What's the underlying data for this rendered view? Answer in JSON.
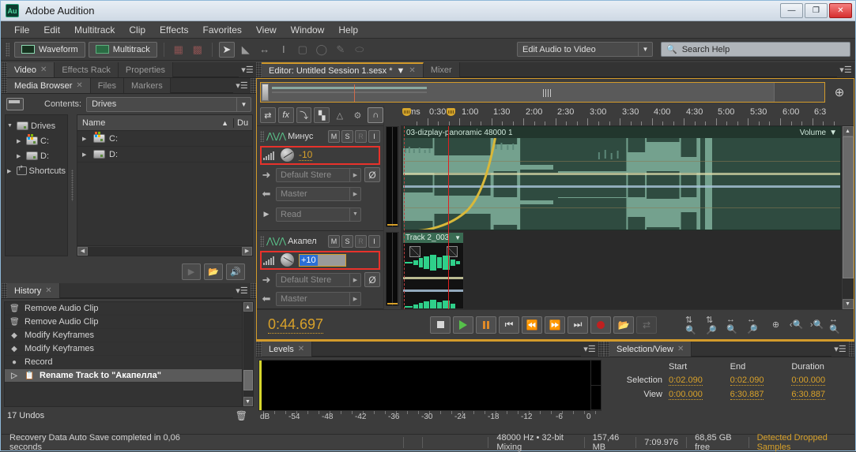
{
  "window": {
    "app_icon": "Au",
    "title": "Adobe Audition",
    "minimize": "—",
    "maximize": "❐",
    "close": "✕"
  },
  "menu": [
    "File",
    "Edit",
    "Multitrack",
    "Clip",
    "Effects",
    "Favorites",
    "View",
    "Window",
    "Help"
  ],
  "toolbar": {
    "waveform_label": "Waveform",
    "multitrack_label": "Multitrack",
    "workspace": "Edit Audio to Video",
    "search_placeholder": "Search Help",
    "search_value": "Search Help"
  },
  "left_panel": {
    "top_tabs": [
      {
        "label": "Video",
        "active": true,
        "closable": true
      },
      {
        "label": "Effects Rack",
        "active": false
      },
      {
        "label": "Properties",
        "active": false
      }
    ],
    "media_browser": {
      "tabs": [
        {
          "label": "Media Browser",
          "active": true,
          "closable": true
        },
        {
          "label": "Files",
          "active": false
        },
        {
          "label": "Markers",
          "active": false
        }
      ],
      "contents_label": "Contents:",
      "contents_value": "Drives",
      "tree": [
        {
          "label": "Drives",
          "expanded": true,
          "depth": 0,
          "icon": "drive-icon"
        },
        {
          "label": "C:",
          "expanded": false,
          "depth": 1,
          "icon": "windows-drive-icon"
        },
        {
          "label": "D:",
          "expanded": false,
          "depth": 1,
          "icon": "drive-icon"
        },
        {
          "label": "Shortcuts",
          "expanded": false,
          "depth": 0,
          "icon": "shortcut-icon"
        }
      ],
      "columns": [
        "Name",
        "Du"
      ],
      "rows": [
        {
          "name": "C:",
          "icon": "windows-drive-icon"
        },
        {
          "name": "D:",
          "icon": "drive-icon"
        }
      ]
    },
    "history": {
      "tabs": [
        {
          "label": "History",
          "active": true,
          "closable": true
        }
      ],
      "items": [
        {
          "label": "Remove Audio Clip",
          "icon": "trash-icon",
          "selected": false
        },
        {
          "label": "Remove Audio Clip",
          "icon": "trash-icon",
          "selected": false
        },
        {
          "label": "Modify Keyframes",
          "icon": "diamond-icon",
          "selected": false
        },
        {
          "label": "Modify Keyframes",
          "icon": "diamond-icon",
          "selected": false
        },
        {
          "label": "Record",
          "icon": "circle-icon",
          "selected": false
        },
        {
          "label": "Rename Track to \"Акапелла\"",
          "icon": "rename-icon",
          "selected": true
        }
      ],
      "undo_count": "17 Undos"
    }
  },
  "editor": {
    "tabs": [
      {
        "label": "Editor: Untitled Session 1.sesx *",
        "active": true,
        "closable": true,
        "has_menu": true
      },
      {
        "label": "Mixer",
        "active": false
      }
    ],
    "ruler_labels": [
      "hms",
      "0:30",
      "1:00",
      "1:30",
      "2:00",
      "2:30",
      "3:00",
      "3:30",
      "4:00",
      "4:30",
      "5:00",
      "5:30",
      "6:00",
      "6:3"
    ],
    "tracks": [
      {
        "name": "Минус",
        "buttons": [
          "M",
          "S",
          "R",
          "I"
        ],
        "volume": "-10",
        "volume_highlighted": true,
        "volume_editing": false,
        "input": "Default Stere",
        "output": "Master",
        "automation": "Read",
        "clip": {
          "name": "03-dizplay-panoramic 48000 1",
          "lane_label": "Volume"
        }
      },
      {
        "name": "Акапел",
        "buttons": [
          "M",
          "S",
          "R",
          "I"
        ],
        "volume": "+10",
        "volume_highlighted": true,
        "volume_editing": true,
        "input": "Default Stere",
        "output": "Master",
        "clip": {
          "name": "Track 2_003"
        }
      }
    ],
    "transport": {
      "time": "0:44.697",
      "buttons": [
        "stop",
        "play",
        "pause",
        "skip-start",
        "rewind",
        "fast-forward",
        "skip-end",
        "record",
        "loop",
        "punch"
      ]
    },
    "zoom_buttons": [
      "zoom-in-amplitude",
      "zoom-out-amplitude",
      "zoom-in-time",
      "zoom-out-time",
      "zoom-out-full",
      "zoom-to-selection-in",
      "zoom-to-selection-out",
      "zoom-to-selection"
    ]
  },
  "levels": {
    "tabs": [
      {
        "label": "Levels",
        "active": true,
        "closable": true
      }
    ],
    "db_label": "dB",
    "scale": [
      "-54",
      "-48",
      "-42",
      "-36",
      "-30",
      "-24",
      "-18",
      "-12",
      "-6",
      "0"
    ]
  },
  "selection_view": {
    "tabs": [
      {
        "label": "Selection/View",
        "active": true,
        "closable": true
      }
    ],
    "columns": [
      "Start",
      "End",
      "Duration"
    ],
    "rows": [
      {
        "label": "Selection",
        "start": "0:02.090",
        "end": "0:02.090",
        "duration": "0:00.000"
      },
      {
        "label": "View",
        "start": "0:00.000",
        "end": "6:30.887",
        "duration": "6:30.887"
      }
    ]
  },
  "statusbar": {
    "message": "Recovery Data Auto Save completed in 0,06 seconds",
    "sample_rate": "48000 Hz • 32-bit Mixing",
    "file_size": "157,46 MB",
    "duration": "7:09.976",
    "free_space": "68,85 GB free",
    "warning": "Detected Dropped Samples"
  },
  "colors": {
    "accent": "#d39b2b",
    "highlight_red": "#e8322b",
    "playhead": "#e02020",
    "waveform_green": "#74a18e",
    "text_value": "#d8a12a"
  }
}
